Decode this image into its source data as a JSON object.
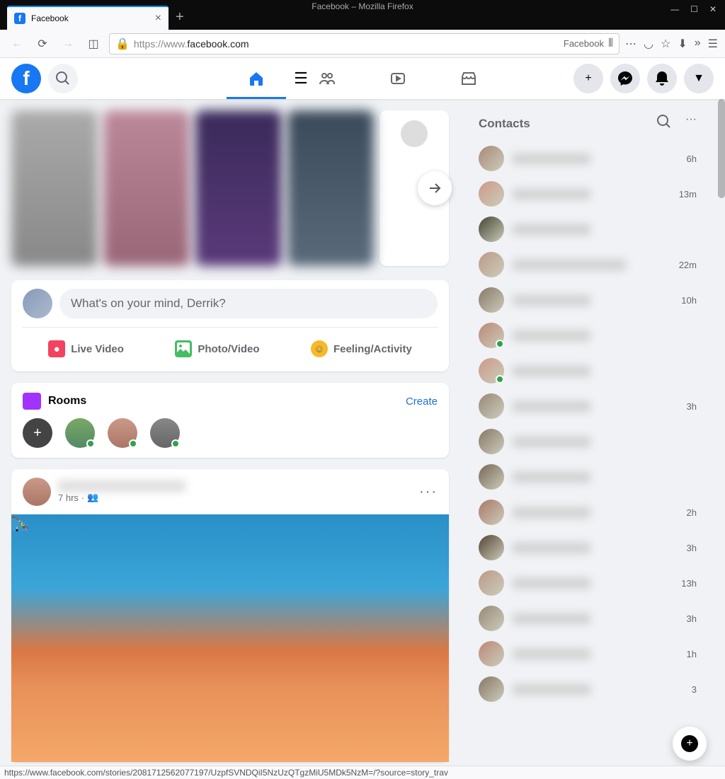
{
  "window": {
    "title": "Facebook – Mozilla Firefox",
    "tab_title": "Facebook",
    "url_display_prefix": "https://www.",
    "url_display_domain": "facebook.com",
    "url_right_label": "Facebook"
  },
  "composer": {
    "placeholder": "What's on your mind, Derrik?",
    "live_video": "Live Video",
    "photo_video": "Photo/Video",
    "feeling_activity": "Feeling/Activity"
  },
  "rooms": {
    "title": "Rooms",
    "create": "Create"
  },
  "post": {
    "time": "7 hrs"
  },
  "contacts": {
    "title": "Contacts",
    "items": [
      {
        "time": "6h",
        "online": false
      },
      {
        "time": "13m",
        "online": false
      },
      {
        "time": "",
        "online": false
      },
      {
        "time": "22m",
        "online": false,
        "wide": true
      },
      {
        "time": "10h",
        "online": false
      },
      {
        "time": "",
        "online": true
      },
      {
        "time": "",
        "online": true
      },
      {
        "time": "3h",
        "online": false
      },
      {
        "time": "",
        "online": false
      },
      {
        "time": "",
        "online": false
      },
      {
        "time": "2h",
        "online": false
      },
      {
        "time": "3h",
        "online": false
      },
      {
        "time": "13h",
        "online": false
      },
      {
        "time": "3h",
        "online": false
      },
      {
        "time": "1h",
        "online": false
      },
      {
        "time": "3",
        "online": false
      }
    ]
  },
  "status_url": "https://www.facebook.com/stories/2081712562077197/UzpfSVNDQiI5NzUzQTgzMiU5MDk5NzM=/?source=story_trav"
}
